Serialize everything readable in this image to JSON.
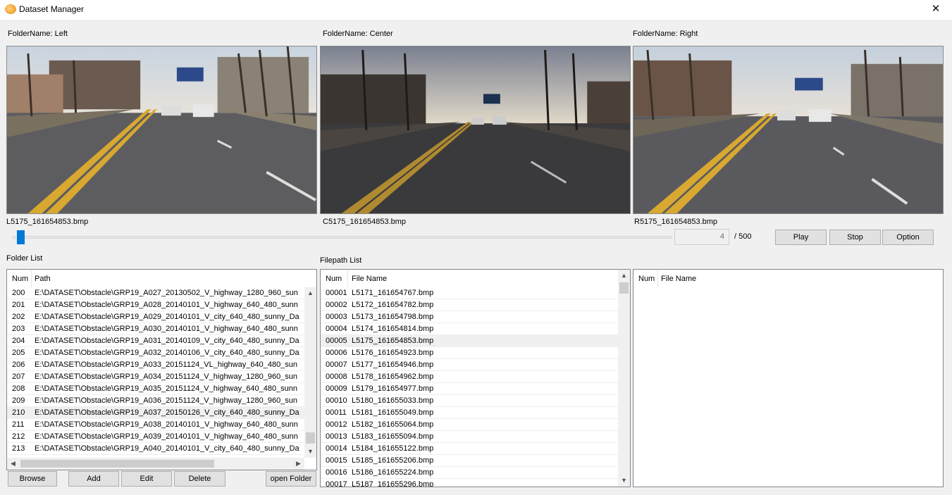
{
  "window": {
    "title": "Dataset Manager",
    "close_glyph": "✕",
    "icon": "app-icon"
  },
  "cameras": [
    {
      "folder_label": "FolderName: Left",
      "filename": "L5175_161654853.bmp"
    },
    {
      "folder_label": "FolderName: Center",
      "filename": "C5175_161654853.bmp"
    },
    {
      "folder_label": "FolderName: Right",
      "filename": "R5175_161654853.bmp"
    }
  ],
  "playback": {
    "frame": "4",
    "total_label": "/ 500",
    "position_fraction": 0.008,
    "buttons": {
      "play": "Play",
      "stop": "Stop",
      "option": "Option"
    }
  },
  "folder_list": {
    "title": "Folder List",
    "columns": [
      "Num",
      "Path"
    ],
    "rows": [
      [
        "200",
        "E:\\DATASET\\Obstacle\\GRP19_A027_20130502_V_highway_1280_960_sun"
      ],
      [
        "201",
        "E:\\DATASET\\Obstacle\\GRP19_A028_20140101_V_highway_640_480_sunn"
      ],
      [
        "202",
        "E:\\DATASET\\Obstacle\\GRP19_A029_20140101_V_city_640_480_sunny_Da"
      ],
      [
        "203",
        "E:\\DATASET\\Obstacle\\GRP19_A030_20140101_V_highway_640_480_sunn"
      ],
      [
        "204",
        "E:\\DATASET\\Obstacle\\GRP19_A031_20140109_V_city_640_480_sunny_Da"
      ],
      [
        "205",
        "E:\\DATASET\\Obstacle\\GRP19_A032_20140106_V_city_640_480_sunny_Da"
      ],
      [
        "206",
        "E:\\DATASET\\Obstacle\\GRP19_A033_20151124_VL_highway_640_480_sun"
      ],
      [
        "207",
        "E:\\DATASET\\Obstacle\\GRP19_A034_20151124_V_highway_1280_960_sun"
      ],
      [
        "208",
        "E:\\DATASET\\Obstacle\\GRP19_A035_20151124_V_highway_640_480_sunn"
      ],
      [
        "209",
        "E:\\DATASET\\Obstacle\\GRP19_A036_20151124_V_highway_1280_960_sun"
      ],
      [
        "210",
        "E:\\DATASET\\Obstacle\\GRP19_A037_20150126_V_city_640_480_sunny_Da"
      ],
      [
        "211",
        "E:\\DATASET\\Obstacle\\GRP19_A038_20140101_V_highway_640_480_sunn"
      ],
      [
        "212",
        "E:\\DATASET\\Obstacle\\GRP19_A039_20140101_V_highway_640_480_sunn"
      ],
      [
        "213",
        "E:\\DATASET\\Obstacle\\GRP19_A040_20140101_V_city_640_480_sunny_Da"
      ]
    ],
    "selected_row": 10,
    "buttons": {
      "browse": "Browse",
      "add": "Add",
      "edit": "Edit",
      "delete": "Delete",
      "open_folder": "open Folder"
    }
  },
  "filepath_list": {
    "title": "Filepath List",
    "columns": [
      "Num",
      "File Name"
    ],
    "rows": [
      [
        "00001",
        "L5171_161654767.bmp"
      ],
      [
        "00002",
        "L5172_161654782.bmp"
      ],
      [
        "00003",
        "L5173_161654798.bmp"
      ],
      [
        "00004",
        "L5174_161654814.bmp"
      ],
      [
        "00005",
        "L5175_161654853.bmp"
      ],
      [
        "00006",
        "L5176_161654923.bmp"
      ],
      [
        "00007",
        "L5177_161654946.bmp"
      ],
      [
        "00008",
        "L5178_161654962.bmp"
      ],
      [
        "00009",
        "L5179_161654977.bmp"
      ],
      [
        "00010",
        "L5180_161655033.bmp"
      ],
      [
        "00011",
        "L5181_161655049.bmp"
      ],
      [
        "00012",
        "L5182_161655064.bmp"
      ],
      [
        "00013",
        "L5183_161655094.bmp"
      ],
      [
        "00014",
        "L5184_161655122.bmp"
      ],
      [
        "00015",
        "L5185_161655206.bmp"
      ],
      [
        "00016",
        "L5186_161655224.bmp"
      ],
      [
        "00017",
        "L5187_161655296.bmp"
      ]
    ],
    "selected_row": 4
  },
  "third_list": {
    "columns": [
      "Num",
      "File Name"
    ]
  },
  "colors": {
    "accent": "#0078d7",
    "selected_row": "#f0f0f0",
    "road_line": "#e0b030"
  }
}
